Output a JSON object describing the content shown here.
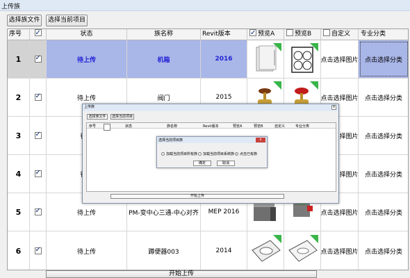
{
  "window": {
    "title": "上传族"
  },
  "toolbar": {
    "select_family_file": "选择族文件",
    "select_current_project": "选择当前项目"
  },
  "table": {
    "headers": {
      "index": "序号",
      "status": "状态",
      "family_name": "族名称",
      "revit_version": "Revit版本",
      "preview_a": "预览A",
      "preview_b": "预览B",
      "custom": "自定义",
      "category": "专业分类"
    },
    "rows": [
      {
        "index": "1",
        "status": "待上传",
        "family_name": "机箱",
        "revit_version": "2016",
        "custom": "点击选择图片",
        "category": "点击选择分类",
        "selected": true
      },
      {
        "index": "2",
        "status": "待上传",
        "family_name": "阀门",
        "revit_version": "2015",
        "custom": "点击选择图片",
        "category": "点击选择分类",
        "selected": false
      },
      {
        "index": "3",
        "status": "待上",
        "family_name": "",
        "revit_version": "",
        "custom": "点击选择图片",
        "category": "点击选择分类",
        "selected": false
      },
      {
        "index": "4",
        "status": "待上",
        "family_name": "",
        "revit_version": "",
        "custom": "点击选择图片",
        "category": "点击选择分类",
        "selected": false
      },
      {
        "index": "5",
        "status": "待上传",
        "family_name": "PM-变中心三通-中心对齐",
        "revit_version": "MEP 2016",
        "custom": "点击选择图片",
        "category": "点击选择分类",
        "selected": false
      },
      {
        "index": "6",
        "status": "待上传",
        "family_name": "蹲便器003",
        "revit_version": "2014",
        "custom": "点击选择图片",
        "category": "点击选择分类",
        "selected": false
      }
    ]
  },
  "start_upload": "开始上传",
  "nested_dialog": {
    "title": "上传族",
    "btn_select_file": "选择族文件",
    "btn_select_project": "选择当前项目",
    "headers": {
      "index": "序号",
      "status": "状态",
      "family_name": "族名称",
      "revit_version": "Revit版本",
      "preview_a": "预览A",
      "preview_b": "预览B",
      "custom": "自定义",
      "category": "专业分类"
    },
    "start_upload": "开始上传"
  },
  "inner_dialog": {
    "title": "选择当前项目族",
    "option_1": "加载当前项目所有族",
    "option_2": "加载当前项目系统族",
    "option_3": "点击已有族",
    "selected_option": 3,
    "ok": "确定",
    "cancel": "取消"
  },
  "colors": {
    "accent_blue": "#2323d6",
    "selected_row": "#d3d3d3",
    "selected_cell": "#a9b6e8",
    "badge_green": "#39b54a",
    "close_red": "#c9413a"
  }
}
